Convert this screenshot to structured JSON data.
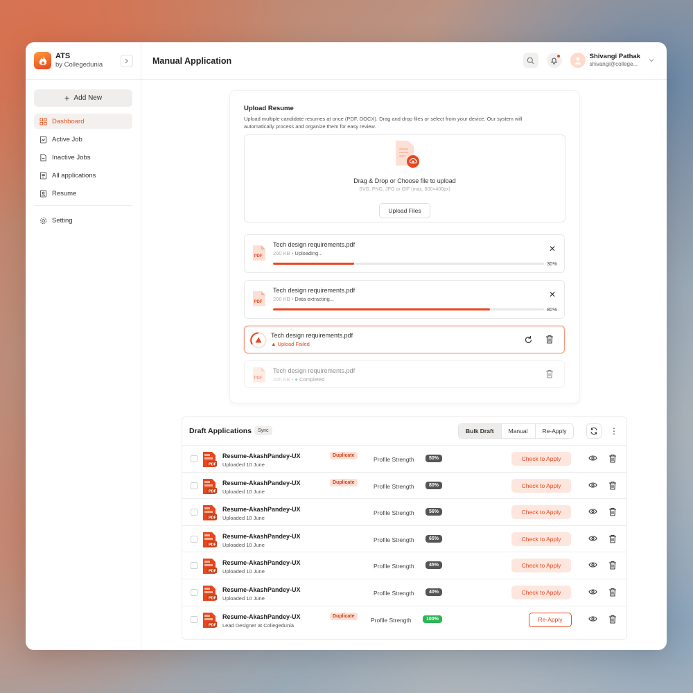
{
  "brand": {
    "name": "ATS",
    "sub": "by Collegedunia"
  },
  "sidebar": {
    "add_new": "Add New",
    "items": [
      {
        "label": "Dashboard",
        "icon": "dashboard-icon"
      },
      {
        "label": "Active Job",
        "icon": "active-job-icon"
      },
      {
        "label": "Inactive Jobs",
        "icon": "inactive-jobs-icon"
      },
      {
        "label": "All applications",
        "icon": "applications-icon"
      },
      {
        "label": "Resume",
        "icon": "resume-icon"
      }
    ],
    "setting": "Setting"
  },
  "header": {
    "title": "Manual Application",
    "user_name": "Shivangi Pathak",
    "user_email": "shivangi@college..."
  },
  "upload": {
    "title": "Upload Resume",
    "description": "Upload multiple candidate resumes at once (PDF, DOCX). Drag and drop files or select from your device. Our system will automatically process and organize them for easy review.",
    "drop_title": "Drag & Drop or Choose file to upload",
    "drop_sub": "SVG, PNG, JPG or GIF (max. 800×400px)",
    "button": "Upload Files",
    "files": [
      {
        "name": "Tech design requirements.pdf",
        "size": "200 KB",
        "status": "Uploading...",
        "progress": 30,
        "progress_label": "30%"
      },
      {
        "name": "Tech design requirements.pdf",
        "size": "200 KB",
        "status": "Data extracting...",
        "progress": 80,
        "progress_label": "80%"
      },
      {
        "name": "Tech design requirements.pdf",
        "status": "Upload Failed"
      },
      {
        "name": "Tech design requirements.pdf",
        "size": "200 KB",
        "status": "Completed"
      }
    ],
    "pdf_label": "PDF"
  },
  "draft": {
    "title": "Draft Applications",
    "sync": "Sync",
    "tabs": [
      "Bulk Draft",
      "Manual",
      "Re-Apply"
    ],
    "active_tab": "Bulk Draft",
    "strength_label": "Profile Strength",
    "check_label": "Check to Apply",
    "reapply_label": "Re-Apply",
    "duplicate_label": "Duplicate",
    "rows": [
      {
        "name": "Resume-AkashPandey-UX",
        "sub": "Uploaded 10 June",
        "duplicate": true,
        "strength": "50%"
      },
      {
        "name": "Resume-AkashPandey-UX",
        "sub": "Uploaded 10 June",
        "duplicate": true,
        "strength": "80%"
      },
      {
        "name": "Resume-AkashPandey-UX",
        "sub": "Uploaded 10 June",
        "duplicate": false,
        "strength": "56%"
      },
      {
        "name": "Resume-AkashPandey-UX",
        "sub": "Uploaded 10 June",
        "duplicate": false,
        "strength": "65%"
      },
      {
        "name": "Resume-AkashPandey-UX",
        "sub": "Uploaded 10 June",
        "duplicate": false,
        "strength": "45%"
      },
      {
        "name": "Resume-AkashPandey-UX",
        "sub": "Uploaded 10 June",
        "duplicate": false,
        "strength": "40%"
      },
      {
        "name": "Resume-AkashPandey-UX",
        "sub": "Lead Designer at Collegedunia",
        "duplicate": true,
        "strength": "100%"
      }
    ]
  },
  "colors": {
    "accent": "#e8461d",
    "success": "#2bb655"
  }
}
